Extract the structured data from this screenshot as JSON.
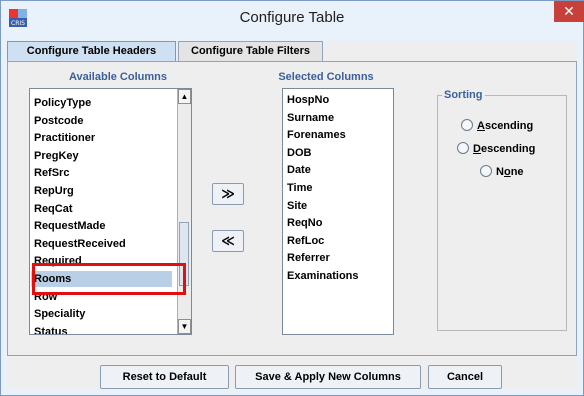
{
  "window": {
    "title": "Configure Table",
    "close_label": "✕"
  },
  "tabs": [
    {
      "label": "Configure Table Headers",
      "active": true
    },
    {
      "label": "Configure Table Filters",
      "active": false
    }
  ],
  "available": {
    "label": "Available Columns",
    "items": [
      "PolicyType",
      "Postcode",
      "Practitioner",
      "PregKey",
      "RefSrc",
      "RepUrg",
      "ReqCat",
      "RequestMade",
      "RequestReceived",
      "Required",
      "Rooms",
      "Row",
      "Speciality",
      "Status"
    ],
    "selected_item": "Rooms"
  },
  "selected": {
    "label": "Selected Columns",
    "items": [
      "HospNo",
      "Surname",
      "Forenames",
      "DOB",
      "Date",
      "Time",
      "Site",
      "ReqNo",
      "RefLoc",
      "Referrer",
      "Examinations"
    ]
  },
  "move": {
    "add_label": "≫",
    "remove_label": "≪"
  },
  "sorting": {
    "title": "Sorting",
    "ascending": {
      "mnemonic": "A",
      "rest": "scending"
    },
    "descending": {
      "mnemonic": "D",
      "rest": "escending"
    },
    "none": {
      "pre": "N",
      "mnemonic": "o",
      "rest": "ne"
    }
  },
  "buttons": {
    "reset": "Reset to Default",
    "save": "Save & Apply New Columns",
    "cancel": "Cancel"
  },
  "colors": {
    "accent": "#3b5f9c",
    "highlight": "#e01010",
    "close": "#c7413a"
  }
}
